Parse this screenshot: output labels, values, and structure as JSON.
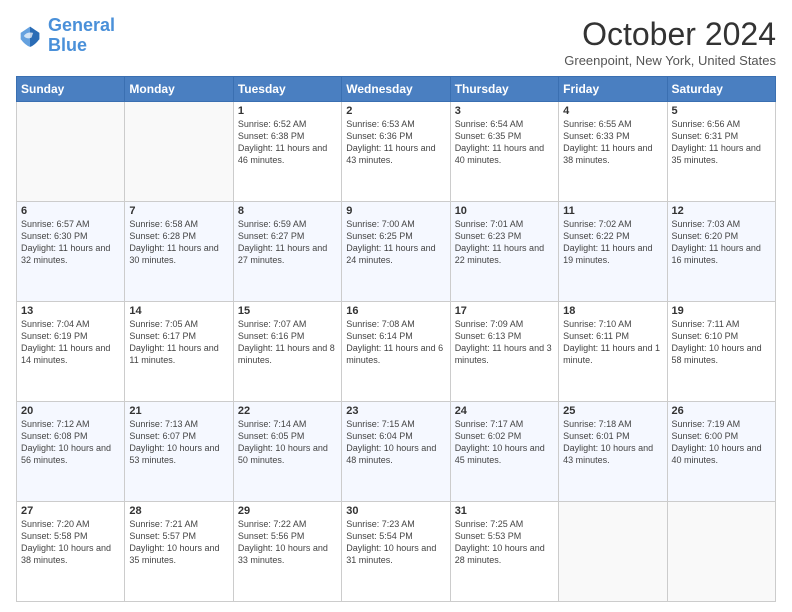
{
  "header": {
    "logo_general": "General",
    "logo_blue": "Blue",
    "month_title": "October 2024",
    "subtitle": "Greenpoint, New York, United States"
  },
  "weekdays": [
    "Sunday",
    "Monday",
    "Tuesday",
    "Wednesday",
    "Thursday",
    "Friday",
    "Saturday"
  ],
  "weeks": [
    [
      {
        "day": "",
        "info": ""
      },
      {
        "day": "",
        "info": ""
      },
      {
        "day": "1",
        "info": "Sunrise: 6:52 AM\nSunset: 6:38 PM\nDaylight: 11 hours and 46 minutes."
      },
      {
        "day": "2",
        "info": "Sunrise: 6:53 AM\nSunset: 6:36 PM\nDaylight: 11 hours and 43 minutes."
      },
      {
        "day": "3",
        "info": "Sunrise: 6:54 AM\nSunset: 6:35 PM\nDaylight: 11 hours and 40 minutes."
      },
      {
        "day": "4",
        "info": "Sunrise: 6:55 AM\nSunset: 6:33 PM\nDaylight: 11 hours and 38 minutes."
      },
      {
        "day": "5",
        "info": "Sunrise: 6:56 AM\nSunset: 6:31 PM\nDaylight: 11 hours and 35 minutes."
      }
    ],
    [
      {
        "day": "6",
        "info": "Sunrise: 6:57 AM\nSunset: 6:30 PM\nDaylight: 11 hours and 32 minutes."
      },
      {
        "day": "7",
        "info": "Sunrise: 6:58 AM\nSunset: 6:28 PM\nDaylight: 11 hours and 30 minutes."
      },
      {
        "day": "8",
        "info": "Sunrise: 6:59 AM\nSunset: 6:27 PM\nDaylight: 11 hours and 27 minutes."
      },
      {
        "day": "9",
        "info": "Sunrise: 7:00 AM\nSunset: 6:25 PM\nDaylight: 11 hours and 24 minutes."
      },
      {
        "day": "10",
        "info": "Sunrise: 7:01 AM\nSunset: 6:23 PM\nDaylight: 11 hours and 22 minutes."
      },
      {
        "day": "11",
        "info": "Sunrise: 7:02 AM\nSunset: 6:22 PM\nDaylight: 11 hours and 19 minutes."
      },
      {
        "day": "12",
        "info": "Sunrise: 7:03 AM\nSunset: 6:20 PM\nDaylight: 11 hours and 16 minutes."
      }
    ],
    [
      {
        "day": "13",
        "info": "Sunrise: 7:04 AM\nSunset: 6:19 PM\nDaylight: 11 hours and 14 minutes."
      },
      {
        "day": "14",
        "info": "Sunrise: 7:05 AM\nSunset: 6:17 PM\nDaylight: 11 hours and 11 minutes."
      },
      {
        "day": "15",
        "info": "Sunrise: 7:07 AM\nSunset: 6:16 PM\nDaylight: 11 hours and 8 minutes."
      },
      {
        "day": "16",
        "info": "Sunrise: 7:08 AM\nSunset: 6:14 PM\nDaylight: 11 hours and 6 minutes."
      },
      {
        "day": "17",
        "info": "Sunrise: 7:09 AM\nSunset: 6:13 PM\nDaylight: 11 hours and 3 minutes."
      },
      {
        "day": "18",
        "info": "Sunrise: 7:10 AM\nSunset: 6:11 PM\nDaylight: 11 hours and 1 minute."
      },
      {
        "day": "19",
        "info": "Sunrise: 7:11 AM\nSunset: 6:10 PM\nDaylight: 10 hours and 58 minutes."
      }
    ],
    [
      {
        "day": "20",
        "info": "Sunrise: 7:12 AM\nSunset: 6:08 PM\nDaylight: 10 hours and 56 minutes."
      },
      {
        "day": "21",
        "info": "Sunrise: 7:13 AM\nSunset: 6:07 PM\nDaylight: 10 hours and 53 minutes."
      },
      {
        "day": "22",
        "info": "Sunrise: 7:14 AM\nSunset: 6:05 PM\nDaylight: 10 hours and 50 minutes."
      },
      {
        "day": "23",
        "info": "Sunrise: 7:15 AM\nSunset: 6:04 PM\nDaylight: 10 hours and 48 minutes."
      },
      {
        "day": "24",
        "info": "Sunrise: 7:17 AM\nSunset: 6:02 PM\nDaylight: 10 hours and 45 minutes."
      },
      {
        "day": "25",
        "info": "Sunrise: 7:18 AM\nSunset: 6:01 PM\nDaylight: 10 hours and 43 minutes."
      },
      {
        "day": "26",
        "info": "Sunrise: 7:19 AM\nSunset: 6:00 PM\nDaylight: 10 hours and 40 minutes."
      }
    ],
    [
      {
        "day": "27",
        "info": "Sunrise: 7:20 AM\nSunset: 5:58 PM\nDaylight: 10 hours and 38 minutes."
      },
      {
        "day": "28",
        "info": "Sunrise: 7:21 AM\nSunset: 5:57 PM\nDaylight: 10 hours and 35 minutes."
      },
      {
        "day": "29",
        "info": "Sunrise: 7:22 AM\nSunset: 5:56 PM\nDaylight: 10 hours and 33 minutes."
      },
      {
        "day": "30",
        "info": "Sunrise: 7:23 AM\nSunset: 5:54 PM\nDaylight: 10 hours and 31 minutes."
      },
      {
        "day": "31",
        "info": "Sunrise: 7:25 AM\nSunset: 5:53 PM\nDaylight: 10 hours and 28 minutes."
      },
      {
        "day": "",
        "info": ""
      },
      {
        "day": "",
        "info": ""
      }
    ]
  ]
}
